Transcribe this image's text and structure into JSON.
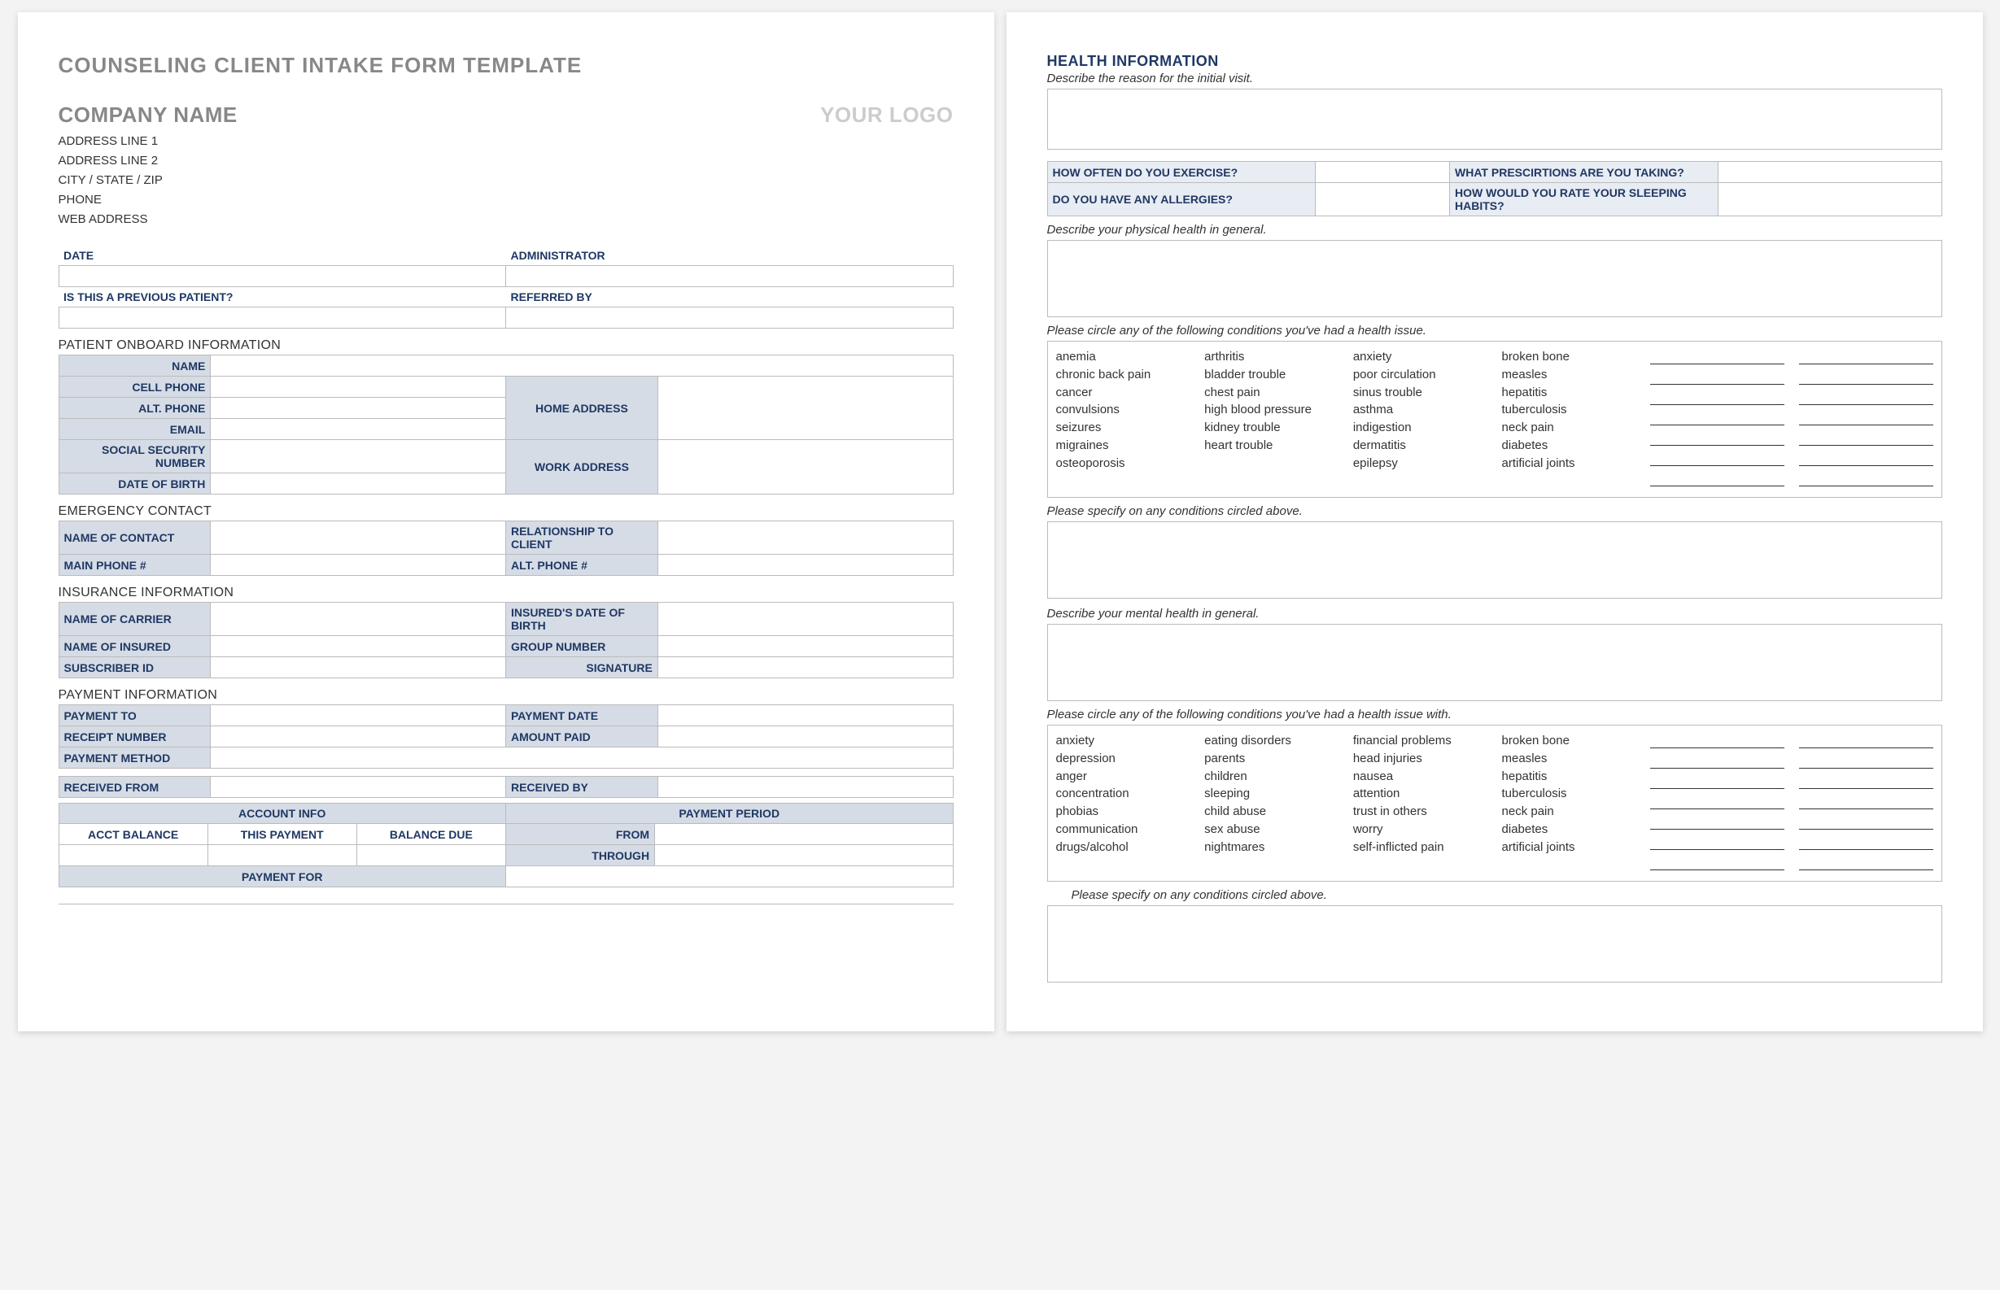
{
  "page1": {
    "title": "COUNSELING CLIENT INTAKE FORM TEMPLATE",
    "company": "COMPANY NAME",
    "logo": "YOUR LOGO",
    "addr1": "ADDRESS LINE 1",
    "addr2": "ADDRESS LINE 2",
    "addr3": "CITY / STATE / ZIP",
    "addr4": "PHONE",
    "addr5": "WEB ADDRESS",
    "date": "DATE",
    "admin": "ADMINISTRATOR",
    "prev": "IS THIS A PREVIOUS PATIENT?",
    "refby": "REFERRED BY",
    "sec_onboard": "PATIENT ONBOARD INFORMATION",
    "name": "NAME",
    "cell": "CELL PHONE",
    "alt": "ALT. PHONE",
    "email": "EMAIL",
    "ssn": "SOCIAL SECURITY NUMBER",
    "dob": "DATE OF BIRTH",
    "homeaddr": "HOME ADDRESS",
    "workaddr": "WORK ADDRESS",
    "sec_emerg": "EMERGENCY CONTACT",
    "em_name": "NAME OF CONTACT",
    "em_rel": "RELATIONSHIP TO CLIENT",
    "em_main": "MAIN PHONE #",
    "em_alt": "ALT. PHONE #",
    "sec_ins": "INSURANCE INFORMATION",
    "ins_carrier": "NAME OF CARRIER",
    "ins_dob": "INSURED'S DATE OF BIRTH",
    "ins_insured": "NAME OF INSURED",
    "ins_group": "GROUP NUMBER",
    "ins_sub": "SUBSCRIBER ID",
    "ins_sig": "SIGNATURE",
    "sec_pay": "PAYMENT INFORMATION",
    "pay_to": "PAYMENT TO",
    "pay_date": "PAYMENT DATE",
    "receipt": "RECEIPT NUMBER",
    "amount": "AMOUNT PAID",
    "method": "PAYMENT METHOD",
    "recv_from": "RECEIVED FROM",
    "recv_by": "RECEIVED BY",
    "acct_info": "ACCOUNT INFO",
    "pay_period": "PAYMENT PERIOD",
    "acct_bal": "ACCT BALANCE",
    "this_pay": "THIS PAYMENT",
    "bal_due": "BALANCE DUE",
    "from": "FROM",
    "through": "THROUGH",
    "pay_for": "PAYMENT FOR"
  },
  "page2": {
    "title": "HEALTH INFORMATION",
    "reason": "Describe the reason for the initial visit.",
    "q_exercise": "HOW OFTEN DO YOU EXERCISE?",
    "q_presc": "WHAT PRESCIRTIONS ARE YOU TAKING?",
    "q_allerg": "DO YOU HAVE ANY ALLERGIES?",
    "q_sleep": "HOW WOULD YOU RATE YOUR SLEEPING HABITS?",
    "phys_desc": "Describe your physical health in general.",
    "phys_circle": "Please circle any of the following conditions you've had a health issue.",
    "phys_spec": "Please specify on any conditions circled above.",
    "ment_desc": "Describe your mental health in general.",
    "ment_circle": "Please circle any of the following conditions you've had a health issue with.",
    "ment_spec": "Please specify on any conditions circled above.",
    "phys_cols": {
      "c1": [
        "anemia",
        "chronic back pain",
        "cancer",
        "convulsions",
        "seizures",
        "migraines",
        "osteoporosis"
      ],
      "c2": [
        "arthritis",
        "bladder trouble",
        "chest pain",
        "high blood pressure",
        "kidney trouble",
        "heart trouble"
      ],
      "c3": [
        "anxiety",
        "poor circulation",
        "sinus trouble",
        "asthma",
        "indigestion",
        "dermatitis",
        "epilepsy"
      ],
      "c4": [
        "broken bone",
        "measles",
        "hepatitis",
        "tuberculosis",
        "neck pain",
        "diabetes",
        "artificial joints"
      ]
    },
    "ment_cols": {
      "c1": [
        "anxiety",
        "depression",
        "anger",
        "concentration",
        "phobias",
        "communication",
        "drugs/alcohol"
      ],
      "c2": [
        "eating disorders",
        "parents",
        "children",
        "sleeping",
        "child abuse",
        "sex abuse",
        "nightmares"
      ],
      "c3": [
        "financial problems",
        "head injuries",
        "nausea",
        "attention",
        "trust in others",
        "worry",
        "self-inflicted pain"
      ],
      "c4": [
        "broken bone",
        "measles",
        "hepatitis",
        "tuberculosis",
        "neck pain",
        "diabetes",
        "artificial joints"
      ]
    }
  }
}
